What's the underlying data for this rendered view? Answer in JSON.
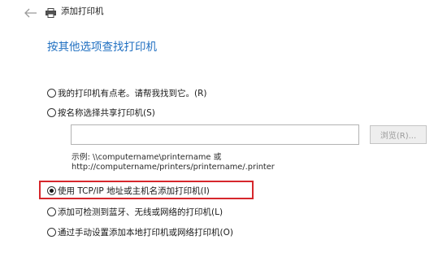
{
  "window": {
    "title": "添加打印机",
    "back_icon": "arrow-left-icon",
    "printer_icon": "printer-icon"
  },
  "heading": "按其他选项查找打印机",
  "options": [
    {
      "label": "我的打印机有点老。请帮我找到它。(R)",
      "selected": false
    },
    {
      "label": "按名称选择共享打印机(S)",
      "selected": false
    },
    {
      "label": "使用 TCP/IP 地址或主机名添加打印机(I)",
      "selected": true
    },
    {
      "label": "添加可检测到蓝牙、无线或网络的打印机(L)",
      "selected": false
    },
    {
      "label": "通过手动设置添加本地打印机或网络打印机(O)",
      "selected": false
    }
  ],
  "share_input": {
    "value": "",
    "placeholder": ""
  },
  "browse_button": {
    "label": "浏览(R)...",
    "enabled": false
  },
  "example": {
    "line1": "示例: \\\\computername\\printername 或",
    "line2": "http://computername/printers/printername/.printer"
  },
  "colors": {
    "heading": "#1f6fc1",
    "highlight": "#d6272c",
    "disabled_text": "#9b9b9b"
  }
}
